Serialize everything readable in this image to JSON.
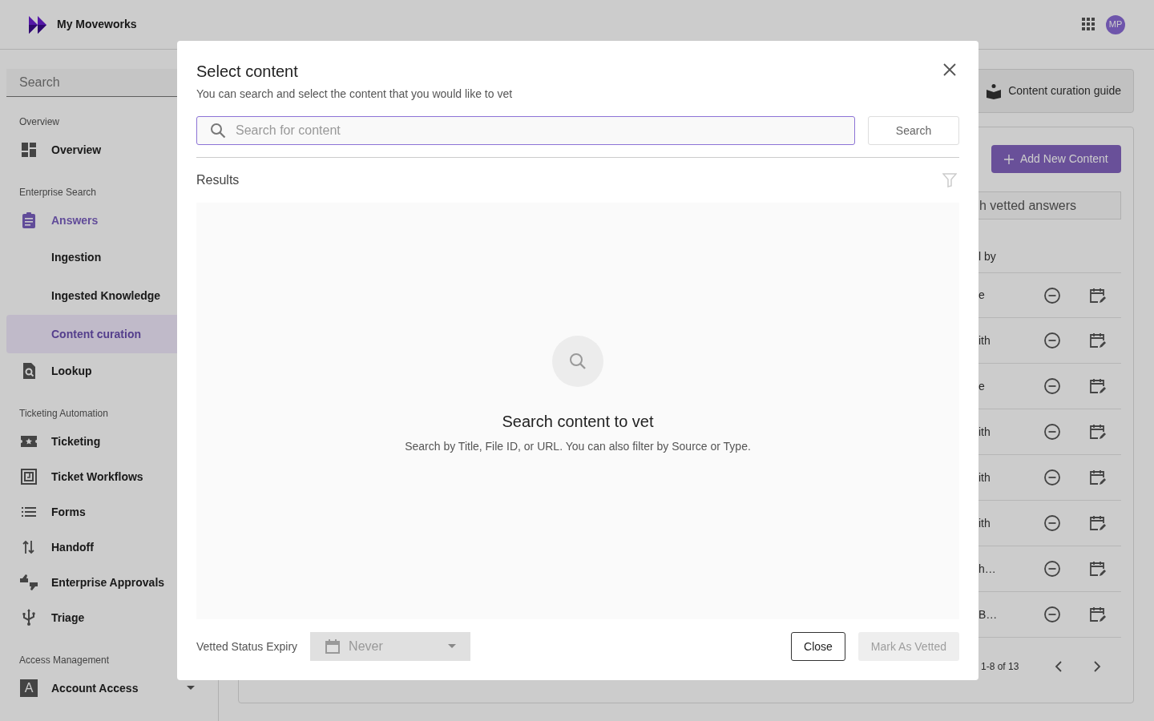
{
  "app": {
    "title": "My Moveworks",
    "user_initials": "MP"
  },
  "sidebar": {
    "search_placeholder": "Search",
    "sections": [
      {
        "heading": "Overview",
        "items": [
          {
            "label": "Overview",
            "active": false
          }
        ]
      },
      {
        "heading": "Enterprise Search",
        "items": [
          {
            "label": "Answers",
            "active": true,
            "expanded": true,
            "children": [
              {
                "label": "Ingestion",
                "selected": false
              },
              {
                "label": "Ingested Knowledge",
                "selected": false
              },
              {
                "label": "Content curation",
                "selected": true
              }
            ]
          },
          {
            "label": "Lookup",
            "active": false
          }
        ]
      },
      {
        "heading": "Ticketing Automation",
        "items": [
          {
            "label": "Ticketing",
            "active": false
          },
          {
            "label": "Ticket Workflows",
            "active": false
          },
          {
            "label": "Forms",
            "active": false
          },
          {
            "label": "Handoff",
            "active": false
          },
          {
            "label": "Enterprise Approvals",
            "active": false
          },
          {
            "label": "Triage",
            "active": false
          }
        ]
      },
      {
        "heading": "Access Management",
        "items": [
          {
            "label": "Account Access",
            "active": false,
            "expanded": false,
            "icon_letter": "A"
          }
        ]
      }
    ]
  },
  "main": {
    "guide_button": "Content curation guide",
    "add_button": "Add New Content",
    "search_fragment": "h vetted answers",
    "column_fragment": "l by",
    "rows": [
      {
        "text": "e"
      },
      {
        "text": "ith"
      },
      {
        "text": "e"
      },
      {
        "text": "ith"
      },
      {
        "text": "ith"
      },
      {
        "text": "ith"
      },
      {
        "text": "h…"
      },
      {
        "text": "B…"
      }
    ],
    "pagination": "1-8 of 13"
  },
  "modal": {
    "title": "Select content",
    "subtitle": "You can search and select the content that you would like to vet",
    "search_placeholder": "Search for content",
    "search_button": "Search",
    "results_label": "Results",
    "empty_title": "Search content to vet",
    "empty_text": "Search by Title, File ID, or URL. You can also filter by Source or Type.",
    "expiry_label": "Vetted Status Expiry",
    "expiry_value": "Never",
    "close_button": "Close",
    "vet_button": {
      "label": "Mark As Vetted",
      "disabled": true
    }
  }
}
